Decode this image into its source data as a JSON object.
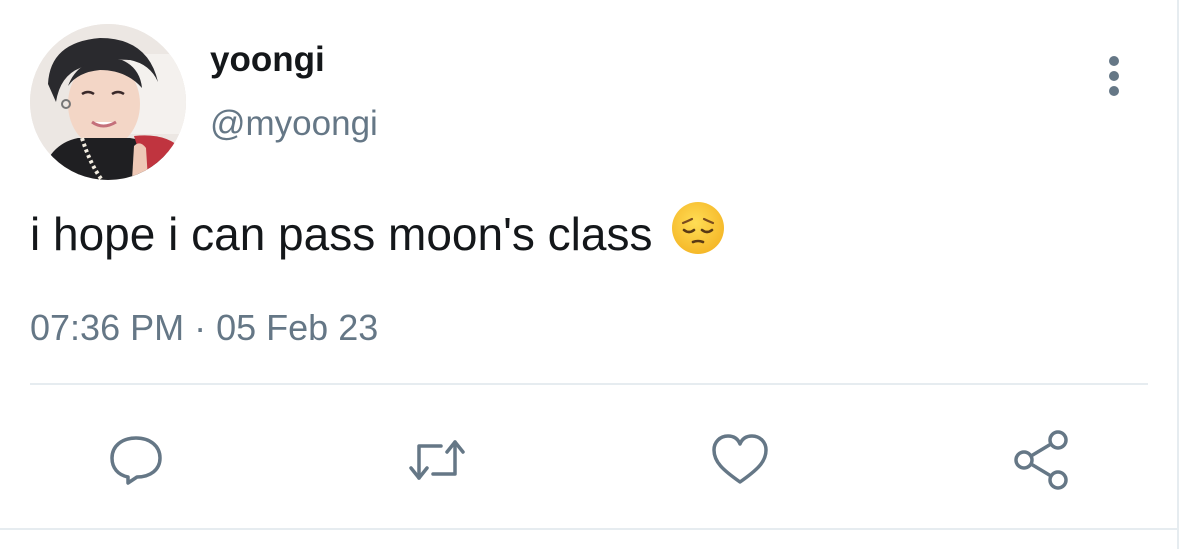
{
  "tweet": {
    "display_name": "yoongi",
    "handle": "@myoongi",
    "text": "i hope i can pass moon's class",
    "emoji": "pensive-face-emoji",
    "time": "07:36 PM",
    "separator": "·",
    "date": "05 Feb 23"
  },
  "actions": [
    {
      "name": "reply",
      "icon": "reply-icon"
    },
    {
      "name": "retweet",
      "icon": "retweet-icon"
    },
    {
      "name": "like",
      "icon": "heart-icon"
    },
    {
      "name": "share",
      "icon": "share-icon"
    }
  ],
  "colors": {
    "text": "#14171a",
    "secondary": "#657786",
    "divider": "#e6ecf0"
  }
}
